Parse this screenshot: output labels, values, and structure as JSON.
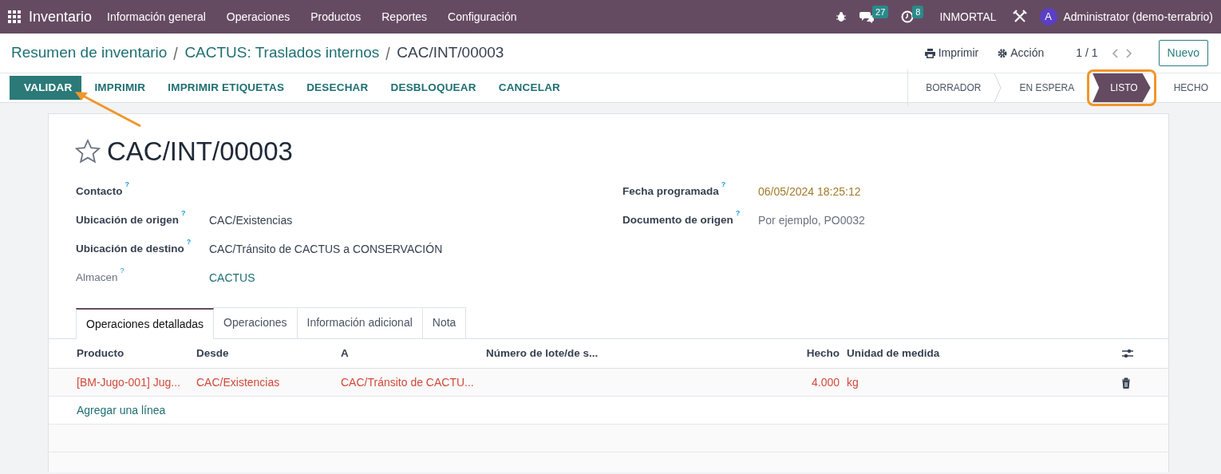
{
  "navbar": {
    "app": "Inventario",
    "menu": [
      "Información general",
      "Operaciones",
      "Productos",
      "Reportes",
      "Configuración"
    ],
    "messages_count": "27",
    "activities_count": "8",
    "company": "INMORTAL",
    "user_initial": "A",
    "user": "Administrator (demo-terrabrio)"
  },
  "breadcrumb": [
    {
      "label": "Resumen de inventario",
      "kind": "link"
    },
    {
      "label": "CACTUS: Traslados internos",
      "kind": "link"
    },
    {
      "label": "CAC/INT/00003",
      "kind": "current"
    }
  ],
  "actions": {
    "print": "Imprimir",
    "action": "Acción",
    "pager": "1 / 1",
    "new": "Nuevo"
  },
  "buttons": [
    {
      "label": "VALIDAR",
      "kind": "primary"
    },
    {
      "label": "IMPRIMIR",
      "kind": "secondary"
    },
    {
      "label": "IMPRIMIR ETIQUETAS",
      "kind": "secondary"
    },
    {
      "label": "DESECHAR",
      "kind": "secondary"
    },
    {
      "label": "DESBLOQUEAR",
      "kind": "secondary"
    },
    {
      "label": "CANCELAR",
      "kind": "secondary"
    }
  ],
  "stages": [
    {
      "label": "BORRADOR",
      "selected": false,
      "highlighted": false
    },
    {
      "label": "EN ESPERA",
      "selected": false,
      "highlighted": false
    },
    {
      "label": "LISTO",
      "selected": true,
      "highlighted": true
    },
    {
      "label": "HECHO",
      "selected": false,
      "highlighted": false
    }
  ],
  "record": {
    "starred": false,
    "name": "CAC/INT/00003"
  },
  "fields_left": [
    {
      "label": "Contacto",
      "help": "?",
      "readonly": false
    },
    {
      "label": "Ubicación de origen",
      "help": "?",
      "readonly": false,
      "value": "CAC/Existencias",
      "kind": "text"
    },
    {
      "label": "Ubicación de destino",
      "help": "?",
      "readonly": false,
      "value": "CAC/Tránsito de CACTUS a CONSERVACIÓN",
      "kind": "text"
    },
    {
      "label": "Almacen",
      "help": "?",
      "readonly": true,
      "value": "CACTUS",
      "kind": "link"
    }
  ],
  "fields_right": [
    {
      "label": "Fecha programada",
      "help": "?",
      "readonly": false,
      "value": "06/05/2024 18:25:12",
      "kind": "warning"
    },
    {
      "label": "Documento de origen",
      "help": "?",
      "readonly": false,
      "placeholder": "Por ejemplo, PO0032",
      "kind": "input"
    }
  ],
  "tabs": [
    {
      "label": "Operaciones detalladas",
      "selected": true
    },
    {
      "label": "Operaciones",
      "selected": false
    },
    {
      "label": "Información adicional",
      "selected": false
    },
    {
      "label": "Nota",
      "selected": false
    }
  ],
  "table": {
    "columns": [
      {
        "label": "Producto",
        "kind": "text"
      },
      {
        "label": "Desde",
        "kind": "text"
      },
      {
        "label": "A",
        "kind": "text"
      },
      {
        "label": "Número de lote/de s...",
        "kind": "text"
      },
      {
        "label": "Hecho",
        "kind": "number"
      },
      {
        "label": "Unidad de medida",
        "kind": "text"
      }
    ],
    "rows": [
      {
        "attention": true,
        "cells": [
          "[BM-Jugo-001] Jug...",
          "CAC/Existencias",
          "CAC/Tránsito de CACTU...",
          "",
          "4.000",
          "kg"
        ]
      }
    ],
    "add_line": "Agregar una línea"
  }
}
